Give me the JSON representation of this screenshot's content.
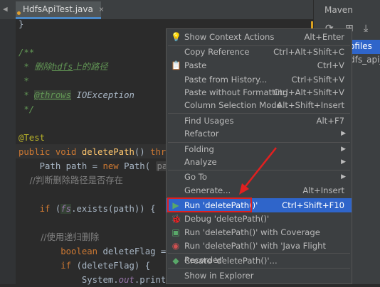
{
  "editor": {
    "tab_title": "HdfsApiTest.java",
    "tab_close": "×",
    "nav_arrow": "◀",
    "lines": {
      "l1": "}",
      "l3a": "/**",
      "l4a": " * ",
      "l4b": "删除",
      "l4c": "hdfs",
      "l4d": "上的路径",
      "l5": " *",
      "l6a": " * ",
      "l6b": "@throws",
      "l6c": " IOException",
      "l7": " */",
      "l9": "@Test",
      "l10a": "public void ",
      "l10b": "deletePath",
      "l10c": "() ",
      "l10d": "throw",
      "l11a": "    Path path = ",
      "l11b": "new",
      "l11c": " Path( ",
      "l11d": "path",
      "l12": "    //判断删除路径是否存在",
      "l14a": "    ",
      "l14b": "if",
      "l14c": " (",
      "l14d": "fs",
      "l14e": ".exists(path)) {",
      "l16": "        //使用递归删除",
      "l17a": "        ",
      "l17b": "boolean",
      "l17c": " deleteFlag = f",
      "l18a": "        ",
      "l18b": "if",
      "l18c": " (deleteFlag) {",
      "l19a": "            System.",
      "l19b": "out",
      "l19c": ".println"
    }
  },
  "maven": {
    "title": "Maven",
    "profiles": "ofiles",
    "project": "dfs_api_"
  },
  "menu": {
    "items": [
      {
        "label": "Show Context Actions",
        "shortcut": "Alt+Enter"
      },
      {
        "label": "Copy Reference",
        "shortcut": "Ctrl+Alt+Shift+C"
      },
      {
        "label": "Paste",
        "shortcut": "Ctrl+V"
      },
      {
        "label": "Paste from History...",
        "shortcut": "Ctrl+Shift+V"
      },
      {
        "label": "Paste without Formatting",
        "shortcut": "Ctrl+Alt+Shift+V"
      },
      {
        "label": "Column Selection Mode",
        "shortcut": "Alt+Shift+Insert"
      },
      {
        "label": "Find Usages",
        "shortcut": "Alt+F7"
      },
      {
        "label": "Refactor",
        "shortcut": ""
      },
      {
        "label": "Folding",
        "shortcut": ""
      },
      {
        "label": "Analyze",
        "shortcut": ""
      },
      {
        "label": "Go To",
        "shortcut": ""
      },
      {
        "label": "Generate...",
        "shortcut": "Alt+Insert"
      },
      {
        "label": "Run 'deletePath()'",
        "shortcut": "Ctrl+Shift+F10"
      },
      {
        "label": "Debug 'deletePath()'",
        "shortcut": ""
      },
      {
        "label": "Run 'deletePath()' with Coverage",
        "shortcut": ""
      },
      {
        "label": "Run 'deletePath()' with 'Java Flight Recorder'",
        "shortcut": ""
      },
      {
        "label": "Create 'deletePath()'...",
        "shortcut": ""
      },
      {
        "label": "Show in Explorer",
        "shortcut": ""
      }
    ],
    "submenu_arrow": "▶"
  },
  "colors": {
    "menu_bg": "#3c3f41",
    "selection": "#2f65ca",
    "annotation_red": "#e02020",
    "editor_bg": "#2b2b2b"
  }
}
